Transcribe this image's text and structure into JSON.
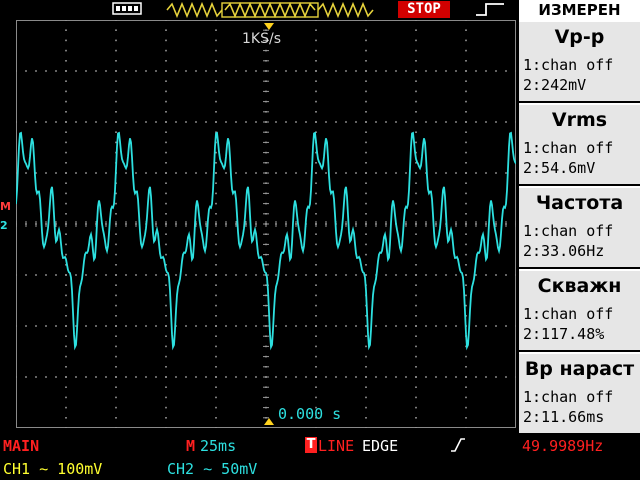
{
  "topbar": {
    "usb_icon": "usb-icon",
    "run_state": "STOP",
    "trigger_edge_icon": "rising-edge-icon"
  },
  "screen": {
    "sample_rate": "1KS/s",
    "trigger_time": "0.000 s",
    "math_marker": "M",
    "ch2_marker": "2",
    "grid_divisions": {
      "x": 10,
      "y": 8
    },
    "trace_color": "#2de0e0"
  },
  "measure_panel": {
    "title": "ИЗМЕРЕН",
    "items": [
      {
        "name": "Vp-p",
        "ch1": "1:chan off",
        "ch2": "2:242mV"
      },
      {
        "name": "Vrms",
        "ch1": "1:chan off",
        "ch2": "2:54.6mV"
      },
      {
        "name": "Частота",
        "ch1": "1:chan off",
        "ch2": "2:33.06Hz"
      },
      {
        "name": "Скважн",
        "ch1": "1:chan off",
        "ch2": "2:117.48%"
      },
      {
        "name": "Вр нараст",
        "ch1": "1:chan off",
        "ch2": "2:11.66ms"
      }
    ]
  },
  "status": {
    "mode": "MAIN",
    "timebase_marker": "M",
    "timebase": "25ms",
    "trigger_marker": "T",
    "trigger_source": "LINE",
    "trigger_type": "EDGE",
    "trigger_slope_icon": "rising-slope-icon",
    "trigger_freq": "49.9989Hz",
    "ch1_label": "CH1 ∼ 100mV",
    "ch2_label": "CH2 ∼ 50mV"
  },
  "colors": {
    "ch2": "#2de0e0",
    "ch1": "#ffff30",
    "accent_red": "#ff2020",
    "stop_bg": "#d20000"
  }
}
